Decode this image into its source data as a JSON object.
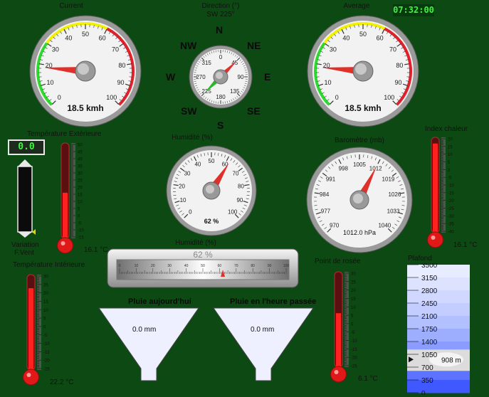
{
  "clock": "07:32:00",
  "gauge_current": {
    "title": "Current",
    "readout": "18.5 kmh",
    "ticks": [
      "0",
      "10",
      "20",
      "30",
      "40",
      "50",
      "60",
      "70",
      "80",
      "90",
      "100"
    ],
    "value": 18.5
  },
  "gauge_average": {
    "title": "Average",
    "readout": "18.5 kmh",
    "ticks": [
      "0",
      "10",
      "20",
      "30",
      "40",
      "50",
      "60",
      "70",
      "80",
      "90",
      "100"
    ],
    "value": 18.5
  },
  "compass": {
    "title": "Direction (°)",
    "subtitle": "SW  225°",
    "N": "N",
    "NE": "NE",
    "E": "E",
    "SE": "SE",
    "S": "S",
    "SW": "SW",
    "W": "W",
    "NW": "NW",
    "ticks": [
      "0",
      "45",
      "90",
      "135",
      "180",
      "225",
      "270",
      "315"
    ],
    "value": 225
  },
  "humidity_gauge": {
    "title": "Humidité (%)",
    "readout": "62 %",
    "ticks": [
      "0",
      "10",
      "20",
      "30",
      "40",
      "50",
      "60",
      "70",
      "80",
      "90",
      "100"
    ],
    "value": 62
  },
  "barometer": {
    "title": "Baromètre (mb)",
    "readout": "1012.0 hPa",
    "ticks": [
      "970",
      "977",
      "984",
      "991",
      "998",
      "1005",
      "1012",
      "1019",
      "1026",
      "1033",
      "1040"
    ],
    "value": 1012
  },
  "variation": {
    "value": "0.0",
    "label_line1": "Variation",
    "label_line2": "F.Vent"
  },
  "temp_ext": {
    "title": "Température Extérieure",
    "readout": "16.1 °C",
    "ticks": [
      "50",
      "45",
      "40",
      "35",
      "30",
      "25",
      "20",
      "15",
      "10",
      "5",
      "0",
      "-5",
      "-10",
      "-15"
    ],
    "value": 16.1
  },
  "temp_int": {
    "title": "Température Intérieure",
    "readout": "22.2 °C",
    "ticks": [
      "30",
      "25",
      "20",
      "15",
      "10",
      "5",
      "0",
      "-5",
      "-10",
      "-15",
      "-20",
      "-25"
    ],
    "value": 22.2
  },
  "dew_point": {
    "title": "Point de rosée",
    "readout": "6.1 °C",
    "ticks": [
      "30",
      "25",
      "20",
      "15",
      "10",
      "5",
      "0",
      "-5",
      "-10",
      "-15",
      "-20",
      "-25"
    ],
    "value": 6.1
  },
  "heat_index": {
    "title": "Index chaleur",
    "readout": "16.1 °C",
    "ticks": [
      "20",
      "15",
      "10",
      "5",
      "0",
      "-5",
      "-10",
      "-15",
      "-20",
      "-25",
      "-30",
      "-35",
      "-40"
    ],
    "value": 16.1
  },
  "humidity_bar": {
    "title": "Humidité (%)",
    "readout": "62 %",
    "ticks": [
      "0",
      "10",
      "20",
      "30",
      "40",
      "50",
      "60",
      "70",
      "80",
      "90",
      "100"
    ],
    "value": 62
  },
  "rain_today": {
    "title": "Pluie aujourd'hui",
    "value": "0.0 mm"
  },
  "rain_hour": {
    "title": "Pluie en l'heure passée",
    "value": "0.0 mm"
  },
  "plafond": {
    "title": "Plafond",
    "readout": "908 m",
    "ticks": [
      "3500",
      "3150",
      "2800",
      "2450",
      "2100",
      "1750",
      "1400",
      "1050",
      "700",
      "350",
      "0"
    ],
    "value": 908
  }
}
